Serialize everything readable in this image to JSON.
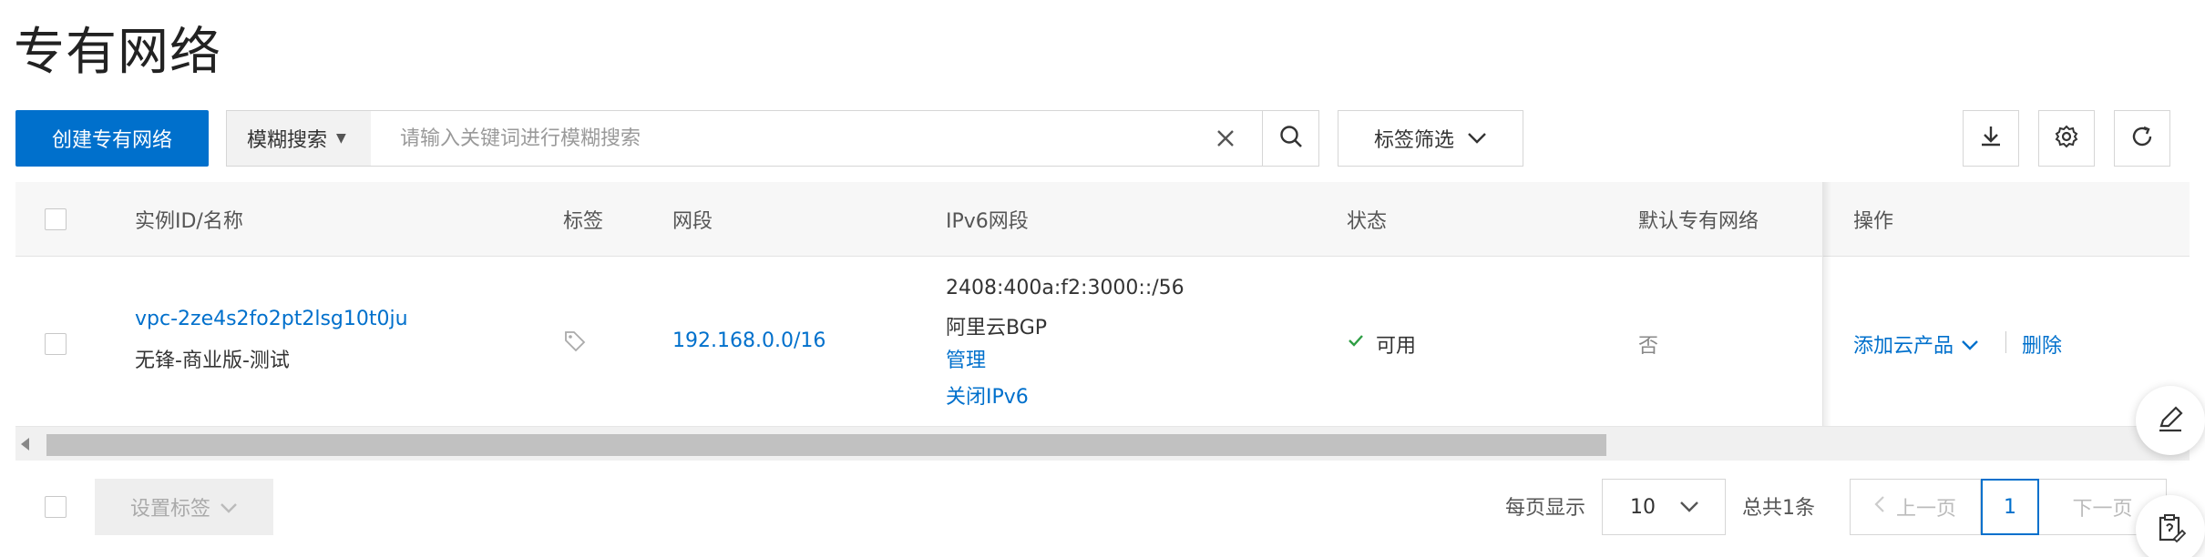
{
  "page": {
    "title": "专有网络"
  },
  "toolbar": {
    "create_label": "创建专有网络",
    "search_mode": "模糊搜索",
    "search_placeholder": "请输入关键词进行模糊搜索",
    "tag_filter_label": "标签筛选"
  },
  "table": {
    "columns": {
      "id_name": "实例ID/名称",
      "tags": "标签",
      "cidr": "网段",
      "ipv6": "IPv6网段",
      "status": "状态",
      "default": "默认专有网络",
      "actions": "操作"
    },
    "rows": [
      {
        "id": "vpc-2ze4s2fo2pt2lsg10t0ju",
        "name": "无锋-商业版-测试",
        "cidr": "192.168.0.0/16",
        "ipv6_cidr": "2408:400a:f2:3000::/56",
        "ipv6_isp": "阿里云BGP",
        "ipv6_manage": "管理",
        "ipv6_close": "关闭IPv6",
        "status": "可用",
        "default": "否",
        "add_product": "添加云产品",
        "delete": "删除"
      }
    ]
  },
  "footer": {
    "set_tags_label": "设置标签",
    "per_page_label": "每页显示",
    "page_size": "10",
    "total_label": "总共1条",
    "prev_label": "上一页",
    "current_page": "1",
    "next_label": "下一页"
  },
  "colors": {
    "primary": "#0070cc",
    "status_ok": "#2e9e44"
  },
  "icons": [
    "chevron-down-icon",
    "close-icon",
    "search-icon",
    "download-icon",
    "gear-icon",
    "refresh-icon",
    "tag-icon",
    "check-icon",
    "edit-icon",
    "clipboard-edit-icon"
  ]
}
